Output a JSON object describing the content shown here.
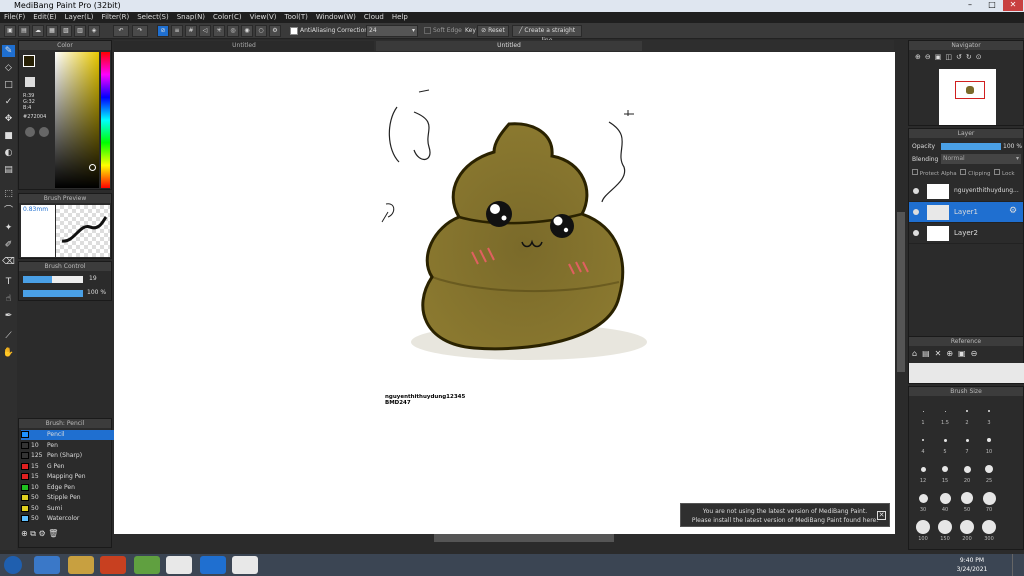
{
  "window": {
    "title": "MediBang Paint Pro (32bit)"
  },
  "menu": [
    "File(F)",
    "Edit(E)",
    "Layer(L)",
    "Filter(R)",
    "Select(S)",
    "Snap(N)",
    "Color(C)",
    "View(V)",
    "Tool(T)",
    "Window(W)",
    "Cloud",
    "Help"
  ],
  "toolbar": {
    "antialiasing_label": "AntiAliasing",
    "correction_label": "Correction",
    "correction_value": "24",
    "soft_edge_label": "Soft Edge",
    "key_label": "Key",
    "reset_label": "Reset",
    "straight_line_label": "Create a straight line"
  },
  "tabs": [
    "Untitled",
    "Untitled"
  ],
  "color_panel": {
    "title": "Color",
    "r": "R:39",
    "g": "G:32",
    "b": "B:4",
    "hex": "#272004"
  },
  "brush_preview": {
    "title": "Brush Preview",
    "size": "0.83mm"
  },
  "brush_control": {
    "title": "Brush Control",
    "size_value": "19",
    "opacity_value": "100 %"
  },
  "brush_list": {
    "title": "Brush: Pencil",
    "items": [
      {
        "size": "",
        "name": "Pencil",
        "color": "#1e90ff",
        "active": true
      },
      {
        "size": "10",
        "name": "Pen",
        "color": "#333333"
      },
      {
        "size": "125",
        "name": "Pen (Sharp)",
        "color": "#333333"
      },
      {
        "size": "15",
        "name": "G Pen",
        "color": "#e02020"
      },
      {
        "size": "15",
        "name": "Mapping Pen",
        "color": "#e02020"
      },
      {
        "size": "10",
        "name": "Edge Pen",
        "color": "#20c020"
      },
      {
        "size": "50",
        "name": "Stipple Pen",
        "color": "#e0d020"
      },
      {
        "size": "50",
        "name": "Sumi",
        "color": "#e0d020"
      },
      {
        "size": "50",
        "name": "Watercolor",
        "color": "#60c0ff"
      }
    ]
  },
  "navigator": {
    "title": "Navigator"
  },
  "layer_panel": {
    "title": "Layer",
    "opacity_label": "Opacity",
    "opacity_value": "100 %",
    "blending_label": "Blending",
    "blending_value": "Normal",
    "protect_alpha": "Protect Alpha",
    "clipping": "Clipping",
    "lock": "Lock",
    "layers": [
      {
        "name": "nguyenthithuydung..."
      },
      {
        "name": "Layer1",
        "active": true
      },
      {
        "name": "Layer2"
      }
    ]
  },
  "reference": {
    "title": "Reference"
  },
  "brush_size": {
    "title": "Brush Size",
    "labels": [
      "1",
      "1.5",
      "2",
      "3",
      "4",
      "5",
      "7",
      "10",
      "12",
      "15",
      "20",
      "25",
      "30",
      "40",
      "50",
      "70",
      "100",
      "150",
      "200",
      "300"
    ]
  },
  "canvas": {
    "signature_line1": "nguyenthithuydung12345",
    "signature_line2": "BMD247"
  },
  "notification": {
    "line1": "You are not using the latest version of MediBang Paint.",
    "line2": "Please install the latest version of MediBang Paint found here."
  },
  "taskbar": {
    "time": "9:40 PM",
    "date": "3/24/2021"
  }
}
